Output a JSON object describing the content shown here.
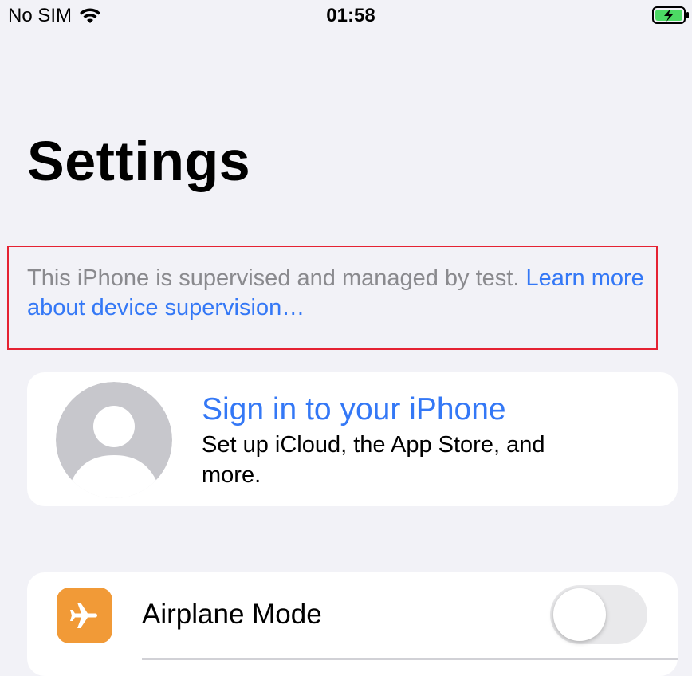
{
  "status_bar": {
    "carrier": "No SIM",
    "time": "01:58",
    "icons": [
      "wifi-icon",
      "battery-charging-icon"
    ]
  },
  "page": {
    "title": "Settings"
  },
  "supervision": {
    "text": "This iPhone is supervised and managed by test. ",
    "link_text": "Learn more about device supervision…"
  },
  "signin": {
    "title": "Sign in to your iPhone",
    "subtitle": "Set up iCloud, the App Store, and more.",
    "icon": "avatar-placeholder-icon"
  },
  "settings": {
    "airplane_mode": {
      "label": "Airplane Mode",
      "icon": "airplane-icon",
      "enabled": false
    }
  },
  "colors": {
    "background": "#f2f2f7",
    "accent": "#3478f6",
    "secondary_text": "#8a8a8e",
    "airplane_icon_bg": "#f19a37",
    "highlight_border": "#e52232",
    "toggle_off": "#e9e9eb"
  }
}
